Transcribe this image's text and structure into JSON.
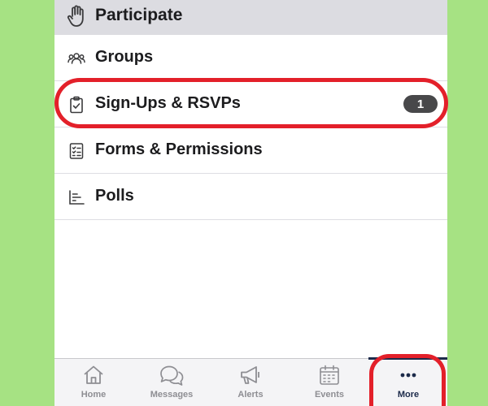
{
  "header": {
    "title": "Participate",
    "icon": "raised-hand-icon"
  },
  "menu": [
    {
      "label": "Groups",
      "icon": "people-icon"
    },
    {
      "label": "Sign-Ups & RSVPs",
      "icon": "clipboard-check-icon",
      "badge": "1"
    },
    {
      "label": "Forms & Permissions",
      "icon": "checklist-form-icon"
    },
    {
      "label": "Polls",
      "icon": "bar-chart-icon"
    }
  ],
  "tabs": [
    {
      "label": "Home",
      "icon": "home-icon"
    },
    {
      "label": "Messages",
      "icon": "chat-bubbles-icon"
    },
    {
      "label": "Alerts",
      "icon": "megaphone-icon"
    },
    {
      "label": "Events",
      "icon": "calendar-icon"
    },
    {
      "label": "More",
      "icon": "more-dots-icon",
      "active": true
    }
  ],
  "colors": {
    "background": "#a6e283",
    "highlight": "#e3202a",
    "badge": "#48484a",
    "active_tab": "#1c2a4a"
  }
}
